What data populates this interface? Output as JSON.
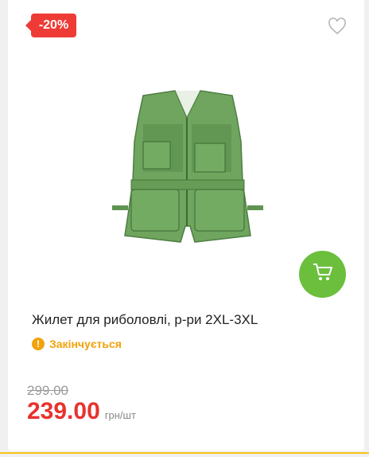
{
  "product": {
    "discount_badge": "-20%",
    "image_icon": "fishing-vest-image",
    "title": "Жилет для риболовлі, р-ри 2XL-3XL",
    "stock_status": "Закінчується",
    "old_price": "299.00",
    "price": "239.00",
    "unit": "грн/шт"
  },
  "icons": {
    "favorite": "heart-outline-icon",
    "cart": "cart-icon",
    "stock": "exclamation-circle-icon"
  },
  "colors": {
    "badge": "#ef3b36",
    "cart_button": "#6bbf3d",
    "stock_warning": "#f2a20c",
    "price": "#e8322e"
  }
}
